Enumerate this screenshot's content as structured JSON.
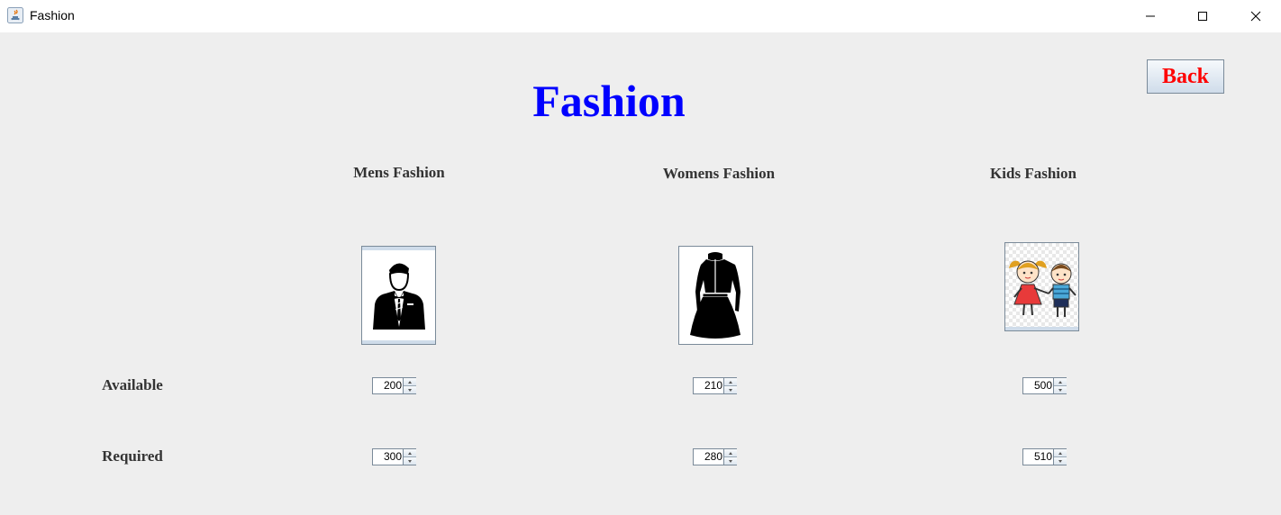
{
  "window": {
    "title": "Fashion",
    "controls": [
      "minimize",
      "maximize",
      "close"
    ]
  },
  "page": {
    "heading": "Fashion",
    "heading_color": "#0000ff",
    "back_label": "Back",
    "back_color": "#ff0000"
  },
  "categories": [
    {
      "label": "Mens Fashion",
      "icon": "mens-suit-icon",
      "available": "200",
      "required": "300"
    },
    {
      "label": "Womens Fashion",
      "icon": "womens-dress-icon",
      "available": "210",
      "required": "280"
    },
    {
      "label": "Kids Fashion",
      "icon": "kids-icon",
      "available": "500",
      "required": "510"
    }
  ],
  "rows": {
    "available": "Available",
    "required": "Required"
  }
}
